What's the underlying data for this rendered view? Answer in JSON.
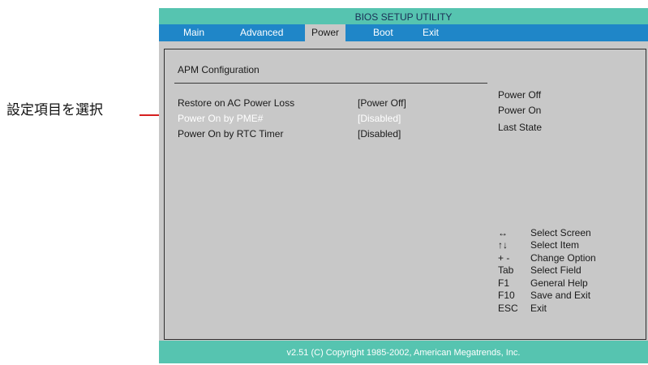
{
  "annotation": {
    "text": "設定項目を選択"
  },
  "window": {
    "title": "BIOS SETUP UTILITY"
  },
  "menu": {
    "tabs": [
      {
        "label": "Main"
      },
      {
        "label": "Advanced"
      },
      {
        "label": "Power"
      },
      {
        "label": "Boot"
      },
      {
        "label": "Exit"
      }
    ],
    "active": "Power"
  },
  "page": {
    "section_title": "APM Configuration",
    "rows": [
      {
        "label": "Restore on AC Power Loss",
        "value": "[Power Off]"
      },
      {
        "label": "Power On by PME#",
        "value": "[Disabled]"
      },
      {
        "label": "Power On by RTC Timer",
        "value": "[Disabled]"
      }
    ]
  },
  "help": {
    "options": [
      "Power Off",
      "Power On",
      "Last State"
    ],
    "keys": [
      {
        "key": "↔",
        "desc": "Select Screen"
      },
      {
        "key": "↑↓",
        "desc": "Select Item"
      },
      {
        "key": "+ -",
        "desc": "Change Option"
      },
      {
        "key": "Tab",
        "desc": "Select Field"
      },
      {
        "key": "F1",
        "desc": "General Help"
      },
      {
        "key": "F10",
        "desc": "Save and Exit"
      },
      {
        "key": "ESC",
        "desc": "Exit"
      }
    ]
  },
  "footer": {
    "text": "v2.51 (C) Copyright 1985-2002, American Megatrends, Inc."
  },
  "colors": {
    "title_bar": "#56c4b0",
    "menu_bar": "#1f86c8",
    "panel": "#c8c8c8",
    "annotation_line": "#d61f1f",
    "selected_text": "#ffffff"
  }
}
